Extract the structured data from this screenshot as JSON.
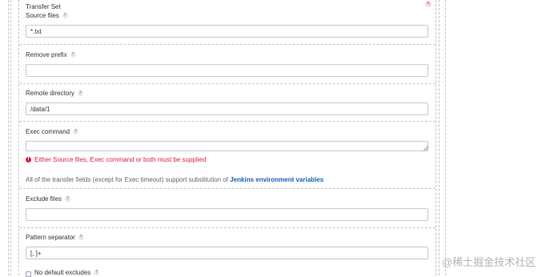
{
  "section": {
    "title": "Transfer Set",
    "close_glyph": "×"
  },
  "fields": {
    "source_files": {
      "label": "Source files",
      "value": "*.txt"
    },
    "remove_prefix": {
      "label": "Remove prefix",
      "value": ""
    },
    "remote_directory": {
      "label": "Remote directory",
      "value": "/data/1"
    },
    "exec_command": {
      "label": "Exec command",
      "value": ""
    },
    "exclude_files": {
      "label": "Exclude files",
      "value": ""
    },
    "pattern_separator": {
      "label": "Pattern separator",
      "value": "[, ]+"
    },
    "no_default_excludes": {
      "label": "No default excludes"
    }
  },
  "help_glyph": "?",
  "error_glyph": "!",
  "error": "Either Source files, Exec command or both must be supplied",
  "note": {
    "text": "All of the transfer fields (except for Exec timeout) support substitution of ",
    "link": "Jenkins environment variables"
  },
  "watermark": "@稀土掘金技术社区",
  "colors": {
    "error": "#d6243b",
    "link": "#1a5fb4",
    "border": "#c9c9d1"
  }
}
